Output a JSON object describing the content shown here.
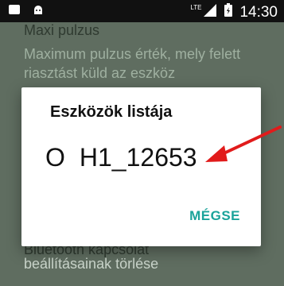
{
  "status_bar": {
    "time": "14:30",
    "network_label": "LTE"
  },
  "background": {
    "item1_title": "Maxi pulzus",
    "item1_desc": "Maximum pulzus érték, mely felett riasztást küld az eszköz",
    "item2_title": "Bluetooth kapcsolat",
    "item2_desc": "beállításainak törlése"
  },
  "dialog": {
    "title": "Eszközök listája",
    "item": {
      "icon_text": "O",
      "label": "H1_12653"
    },
    "cancel_label": "MÉGSE"
  },
  "colors": {
    "accent": "#1aa39a",
    "annotation_arrow": "#e11b1b"
  }
}
